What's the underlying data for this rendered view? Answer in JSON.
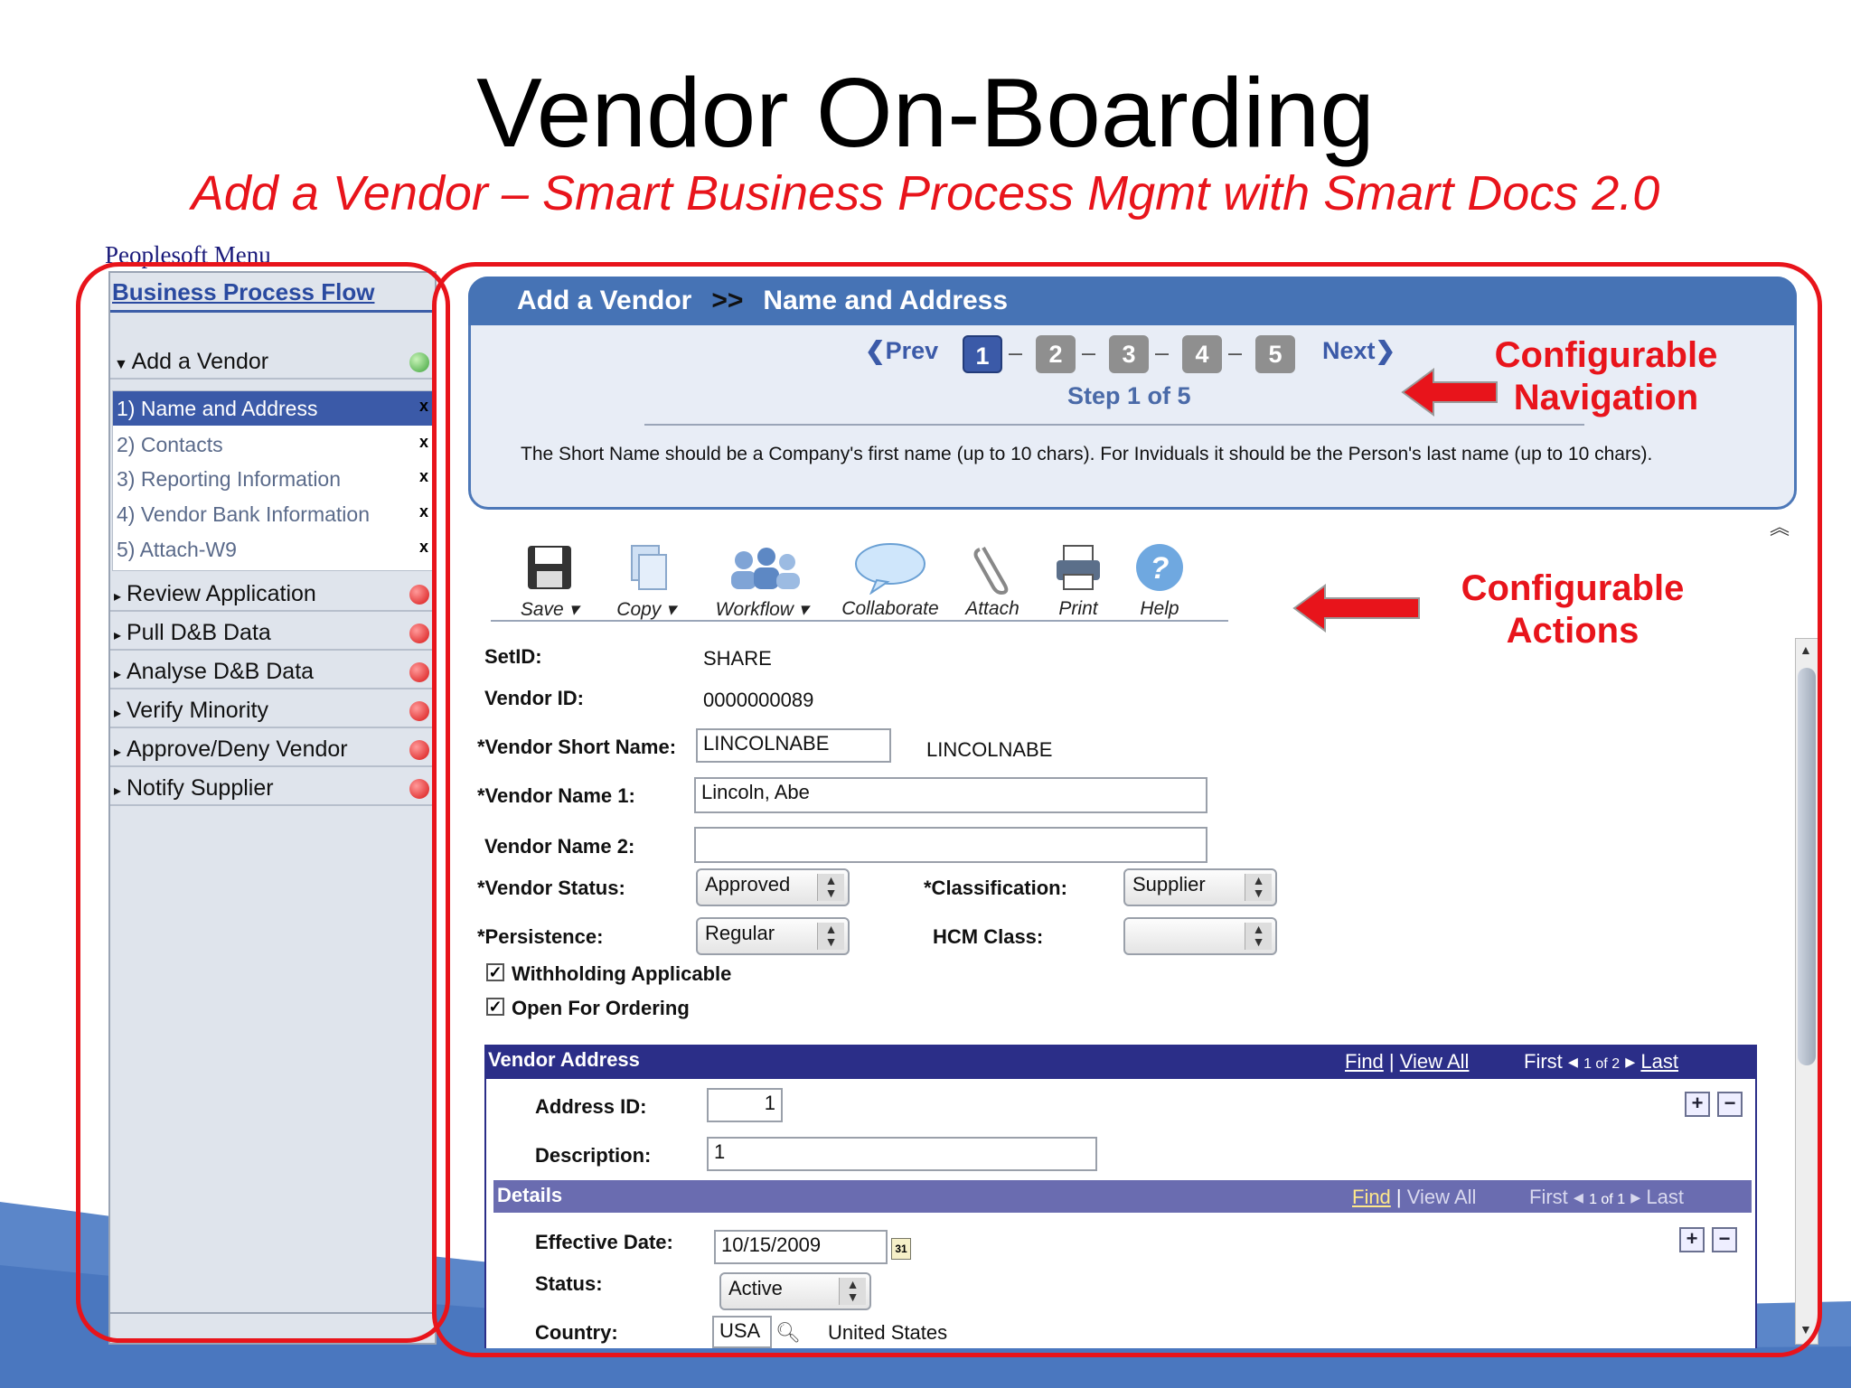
{
  "slide": {
    "title": "Vendor On-Boarding",
    "subtitle": "Add a Vendor – Smart Business Process Mgmt with Smart Docs 2.0"
  },
  "left": {
    "menu_link": "Peoplesoft Menu",
    "panel_title": "Business Process Flow",
    "add_vendor": "Add a Vendor",
    "substeps": [
      {
        "label": "1) Name and Address",
        "x": "x"
      },
      {
        "label": "2) Contacts",
        "x": "x"
      },
      {
        "label": "3) Reporting Information",
        "x": "x"
      },
      {
        "label": "4) Vendor Bank Information",
        "x": "x"
      },
      {
        "label": "5) Attach-W9",
        "x": "x"
      }
    ],
    "steps": [
      "Review Application",
      "Pull D&B Data",
      "Analyse D&B Data",
      "Verify Minority",
      "Approve/Deny Vendor",
      "Notify Supplier"
    ]
  },
  "main": {
    "breadcrumb_1": "Add a Vendor",
    "breadcrumb_sep": ">>",
    "breadcrumb_2": "Name and Address",
    "prev": "Prev",
    "next": "Next",
    "step_numbers": [
      "1",
      "2",
      "3",
      "4",
      "5"
    ],
    "step_sep": "–",
    "step_of": "Step 1 of 5",
    "hint": "The Short Name should be a Company's first name (up to 10 chars). For Inviduals it should be the Person's last name (up to 10 chars).",
    "toolbar": [
      "Save",
      "Copy",
      "Workflow",
      "Collaborate",
      "Attach",
      "Print",
      "Help"
    ]
  },
  "form": {
    "setid_label": "SetID:",
    "setid_value": "SHARE",
    "vendor_id_label": "Vendor ID:",
    "vendor_id_value": "0000000089",
    "short_name_label": "*Vendor Short Name:",
    "short_name_value": "LINCOLNABE",
    "short_name_display": "LINCOLNABE",
    "name1_label": "*Vendor Name 1:",
    "name1_value": "Lincoln, Abe",
    "name2_label": "Vendor Name 2:",
    "name2_value": "",
    "status_label": "*Vendor Status:",
    "status_value": "Approved",
    "classification_label": "*Classification:",
    "classification_value": "Supplier",
    "persistence_label": "*Persistence:",
    "persistence_value": "Regular",
    "hcm_label": "HCM Class:",
    "hcm_value": "",
    "withholding_label": "Withholding Applicable",
    "open_ordering_label": "Open For Ordering"
  },
  "address": {
    "bar_title": "Vendor Address",
    "find": "Find",
    "sep": "|",
    "view_all": "View All",
    "first": "First",
    "count": "1 of 2",
    "last": "Last",
    "address_id_label": "Address ID:",
    "address_id_value": "1",
    "description_label": "Description:",
    "description_value": "1",
    "plus": "+",
    "minus": "−"
  },
  "details": {
    "bar_title": "Details",
    "find": "Find",
    "sep": "|",
    "view_all": "View All",
    "first": "First",
    "count": "1 of 1",
    "last": "Last",
    "effdate_label": "Effective Date:",
    "effdate_value": "10/15/2009",
    "calendar_text": "31",
    "status_label": "Status:",
    "status_value": "Active",
    "country_label": "Country:",
    "country_value": "USA",
    "country_name": "United States"
  },
  "callouts": {
    "nav_1": "Configurable",
    "nav_2": "Navigation",
    "actions_1": "Configurable",
    "actions_2": "Actions"
  },
  "colors": {
    "accent_red": "#e8141b",
    "header_blue": "#4673b5",
    "address_bar": "#2b2e88"
  }
}
